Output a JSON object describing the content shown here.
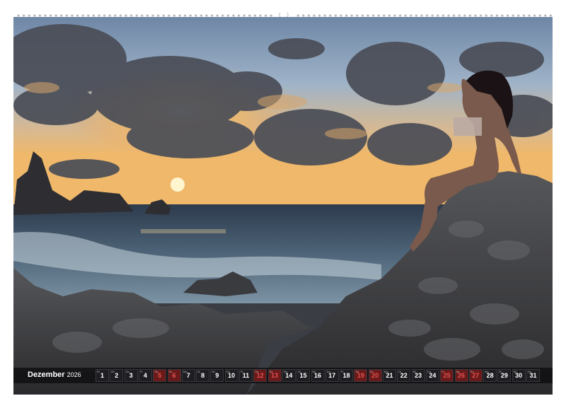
{
  "calendar": {
    "month": "Dezember",
    "year": "2026",
    "days": [
      {
        "d": "1",
        "wd": "Di",
        "we": false
      },
      {
        "d": "2",
        "wd": "Mi",
        "we": false
      },
      {
        "d": "3",
        "wd": "Do",
        "we": false
      },
      {
        "d": "4",
        "wd": "Fr",
        "we": false
      },
      {
        "d": "5",
        "wd": "Sa",
        "we": true
      },
      {
        "d": "6",
        "wd": "So",
        "we": true
      },
      {
        "d": "7",
        "wd": "Mo",
        "we": false
      },
      {
        "d": "8",
        "wd": "Di",
        "we": false
      },
      {
        "d": "9",
        "wd": "Mi",
        "we": false
      },
      {
        "d": "10",
        "wd": "Do",
        "we": false
      },
      {
        "d": "11",
        "wd": "Fr",
        "we": false
      },
      {
        "d": "12",
        "wd": "Sa",
        "we": true
      },
      {
        "d": "13",
        "wd": "So",
        "we": true
      },
      {
        "d": "14",
        "wd": "Mo",
        "we": false
      },
      {
        "d": "15",
        "wd": "Di",
        "we": false
      },
      {
        "d": "16",
        "wd": "Mi",
        "we": false
      },
      {
        "d": "17",
        "wd": "Do",
        "we": false
      },
      {
        "d": "18",
        "wd": "Fr",
        "we": false
      },
      {
        "d": "19",
        "wd": "Sa",
        "we": true
      },
      {
        "d": "20",
        "wd": "So",
        "we": true
      },
      {
        "d": "21",
        "wd": "Mo",
        "we": false
      },
      {
        "d": "22",
        "wd": "Di",
        "we": false
      },
      {
        "d": "23",
        "wd": "Mi",
        "we": false
      },
      {
        "d": "24",
        "wd": "Do",
        "we": false
      },
      {
        "d": "25",
        "wd": "Fr",
        "we": true
      },
      {
        "d": "26",
        "wd": "Sa",
        "we": true
      },
      {
        "d": "27",
        "wd": "So",
        "we": true
      },
      {
        "d": "28",
        "wd": "Mo",
        "we": false
      },
      {
        "d": "29",
        "wd": "Di",
        "we": false
      },
      {
        "d": "30",
        "wd": "Mi",
        "we": false
      },
      {
        "d": "31",
        "wd": "Do",
        "we": false
      }
    ]
  },
  "colors": {
    "weekday_cell": "#1e1e22",
    "holiday_cell": "#6b1a1a",
    "holiday_text": "#e05252",
    "sky": "#8fa7c0",
    "sun": "#ffd36b"
  }
}
